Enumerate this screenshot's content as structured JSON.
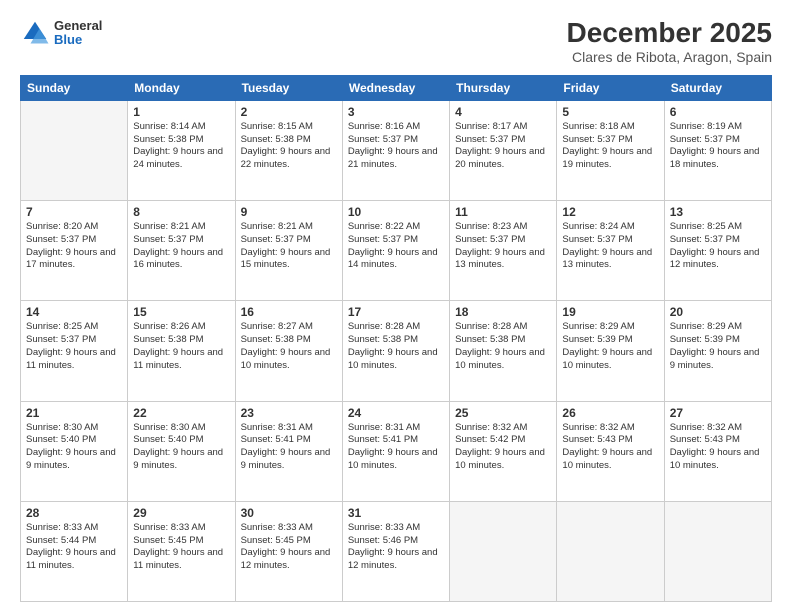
{
  "logo": {
    "general": "General",
    "blue": "Blue"
  },
  "title": "December 2025",
  "subtitle": "Clares de Ribota, Aragon, Spain",
  "days_header": [
    "Sunday",
    "Monday",
    "Tuesday",
    "Wednesday",
    "Thursday",
    "Friday",
    "Saturday"
  ],
  "weeks": [
    [
      {
        "num": "",
        "empty": true
      },
      {
        "num": "1",
        "rise": "8:14 AM",
        "set": "5:38 PM",
        "daylight": "9 hours and 24 minutes."
      },
      {
        "num": "2",
        "rise": "8:15 AM",
        "set": "5:38 PM",
        "daylight": "9 hours and 22 minutes."
      },
      {
        "num": "3",
        "rise": "8:16 AM",
        "set": "5:37 PM",
        "daylight": "9 hours and 21 minutes."
      },
      {
        "num": "4",
        "rise": "8:17 AM",
        "set": "5:37 PM",
        "daylight": "9 hours and 20 minutes."
      },
      {
        "num": "5",
        "rise": "8:18 AM",
        "set": "5:37 PM",
        "daylight": "9 hours and 19 minutes."
      },
      {
        "num": "6",
        "rise": "8:19 AM",
        "set": "5:37 PM",
        "daylight": "9 hours and 18 minutes."
      }
    ],
    [
      {
        "num": "7",
        "rise": "8:20 AM",
        "set": "5:37 PM",
        "daylight": "9 hours and 17 minutes."
      },
      {
        "num": "8",
        "rise": "8:21 AM",
        "set": "5:37 PM",
        "daylight": "9 hours and 16 minutes."
      },
      {
        "num": "9",
        "rise": "8:21 AM",
        "set": "5:37 PM",
        "daylight": "9 hours and 15 minutes."
      },
      {
        "num": "10",
        "rise": "8:22 AM",
        "set": "5:37 PM",
        "daylight": "9 hours and 14 minutes."
      },
      {
        "num": "11",
        "rise": "8:23 AM",
        "set": "5:37 PM",
        "daylight": "9 hours and 13 minutes."
      },
      {
        "num": "12",
        "rise": "8:24 AM",
        "set": "5:37 PM",
        "daylight": "9 hours and 13 minutes."
      },
      {
        "num": "13",
        "rise": "8:25 AM",
        "set": "5:37 PM",
        "daylight": "9 hours and 12 minutes."
      }
    ],
    [
      {
        "num": "14",
        "rise": "8:25 AM",
        "set": "5:37 PM",
        "daylight": "9 hours and 11 minutes."
      },
      {
        "num": "15",
        "rise": "8:26 AM",
        "set": "5:38 PM",
        "daylight": "9 hours and 11 minutes."
      },
      {
        "num": "16",
        "rise": "8:27 AM",
        "set": "5:38 PM",
        "daylight": "9 hours and 10 minutes."
      },
      {
        "num": "17",
        "rise": "8:28 AM",
        "set": "5:38 PM",
        "daylight": "9 hours and 10 minutes."
      },
      {
        "num": "18",
        "rise": "8:28 AM",
        "set": "5:38 PM",
        "daylight": "9 hours and 10 minutes."
      },
      {
        "num": "19",
        "rise": "8:29 AM",
        "set": "5:39 PM",
        "daylight": "9 hours and 10 minutes."
      },
      {
        "num": "20",
        "rise": "8:29 AM",
        "set": "5:39 PM",
        "daylight": "9 hours and 9 minutes."
      }
    ],
    [
      {
        "num": "21",
        "rise": "8:30 AM",
        "set": "5:40 PM",
        "daylight": "9 hours and 9 minutes."
      },
      {
        "num": "22",
        "rise": "8:30 AM",
        "set": "5:40 PM",
        "daylight": "9 hours and 9 minutes."
      },
      {
        "num": "23",
        "rise": "8:31 AM",
        "set": "5:41 PM",
        "daylight": "9 hours and 9 minutes."
      },
      {
        "num": "24",
        "rise": "8:31 AM",
        "set": "5:41 PM",
        "daylight": "9 hours and 10 minutes."
      },
      {
        "num": "25",
        "rise": "8:32 AM",
        "set": "5:42 PM",
        "daylight": "9 hours and 10 minutes."
      },
      {
        "num": "26",
        "rise": "8:32 AM",
        "set": "5:43 PM",
        "daylight": "9 hours and 10 minutes."
      },
      {
        "num": "27",
        "rise": "8:32 AM",
        "set": "5:43 PM",
        "daylight": "9 hours and 10 minutes."
      }
    ],
    [
      {
        "num": "28",
        "rise": "8:33 AM",
        "set": "5:44 PM",
        "daylight": "9 hours and 11 minutes."
      },
      {
        "num": "29",
        "rise": "8:33 AM",
        "set": "5:45 PM",
        "daylight": "9 hours and 11 minutes."
      },
      {
        "num": "30",
        "rise": "8:33 AM",
        "set": "5:45 PM",
        "daylight": "9 hours and 12 minutes."
      },
      {
        "num": "31",
        "rise": "8:33 AM",
        "set": "5:46 PM",
        "daylight": "9 hours and 12 minutes."
      },
      {
        "num": "",
        "empty": true
      },
      {
        "num": "",
        "empty": true
      },
      {
        "num": "",
        "empty": true
      }
    ]
  ]
}
